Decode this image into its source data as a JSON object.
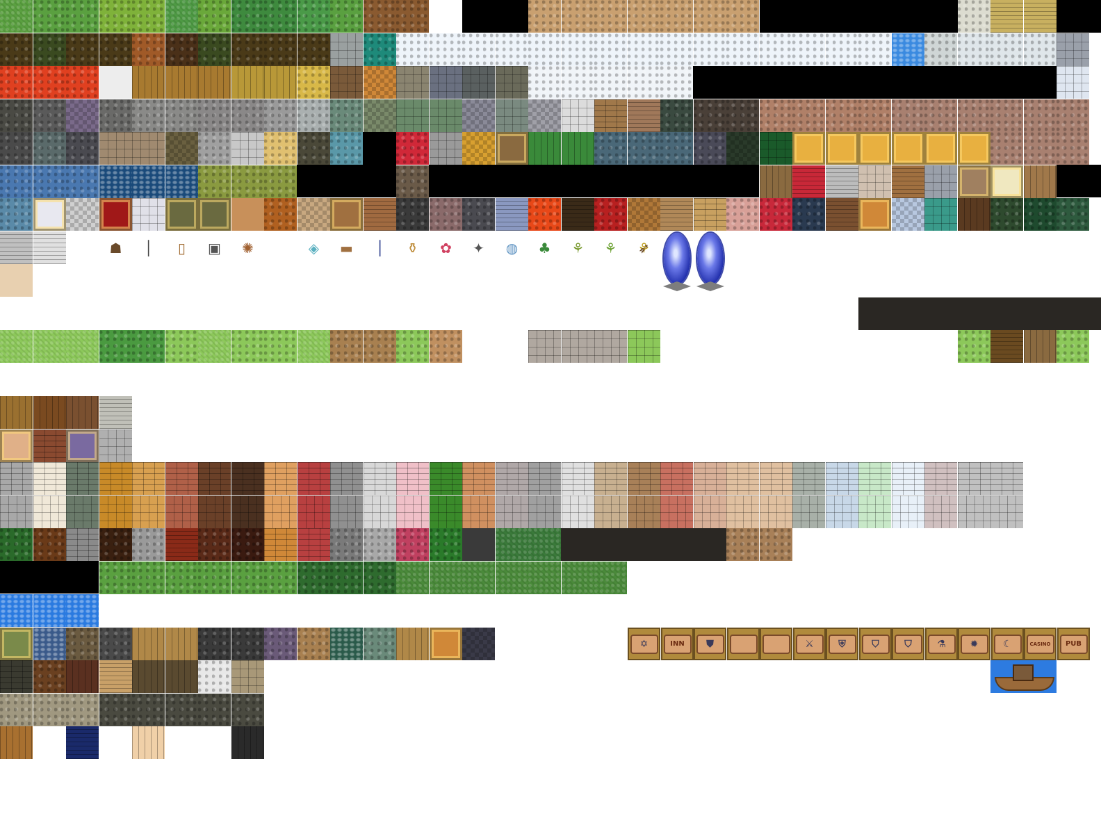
{
  "tileset": {
    "tile_size": 48,
    "signs": [
      {
        "name": "star-of-david",
        "text": "✡",
        "kind": "glyph"
      },
      {
        "name": "inn",
        "text": "INN",
        "kind": "text"
      },
      {
        "name": "shield",
        "text": "⛊",
        "kind": "glyph"
      },
      {
        "name": "blank-1",
        "text": "",
        "kind": "text"
      },
      {
        "name": "blank-2",
        "text": "",
        "kind": "text"
      },
      {
        "name": "weapon",
        "text": "⚔",
        "kind": "glyph"
      },
      {
        "name": "armor",
        "text": "⛨",
        "kind": "glyph"
      },
      {
        "name": "shield-blue",
        "text": "⛉",
        "kind": "glyph"
      },
      {
        "name": "shield-teal",
        "text": "⛉",
        "kind": "glyph"
      },
      {
        "name": "potion",
        "text": "⚗",
        "kind": "glyph"
      },
      {
        "name": "magic",
        "text": "✹",
        "kind": "glyph"
      },
      {
        "name": "accessory",
        "text": "☾",
        "kind": "glyph"
      },
      {
        "name": "casino",
        "text": "CASINO",
        "kind": "text"
      },
      {
        "name": "pub",
        "text": "PUB",
        "kind": "text"
      }
    ],
    "objects": [
      {
        "name": "grindstone",
        "glyph": "☗"
      },
      {
        "name": "candle-stick",
        "glyph": "│"
      },
      {
        "name": "wooden-door",
        "glyph": "▯"
      },
      {
        "name": "iron-door",
        "glyph": "▣"
      },
      {
        "name": "firewood",
        "glyph": "✺"
      },
      {
        "name": "crystal-ore",
        "glyph": "◈"
      },
      {
        "name": "log",
        "glyph": "▬"
      },
      {
        "name": "banner-post",
        "glyph": "│"
      },
      {
        "name": "clay-pot",
        "glyph": "⚱"
      },
      {
        "name": "flower-pot",
        "glyph": "✿"
      },
      {
        "name": "rubble",
        "glyph": "✦"
      },
      {
        "name": "fountain-basin",
        "glyph": "◍"
      },
      {
        "name": "herb-bush",
        "glyph": "♣"
      },
      {
        "name": "sprout",
        "glyph": "⚘"
      },
      {
        "name": "sapling",
        "glyph": "⚘"
      },
      {
        "name": "corn-plant",
        "glyph": "⚘"
      },
      {
        "name": "bird",
        "glyph": "➶"
      }
    ]
  }
}
